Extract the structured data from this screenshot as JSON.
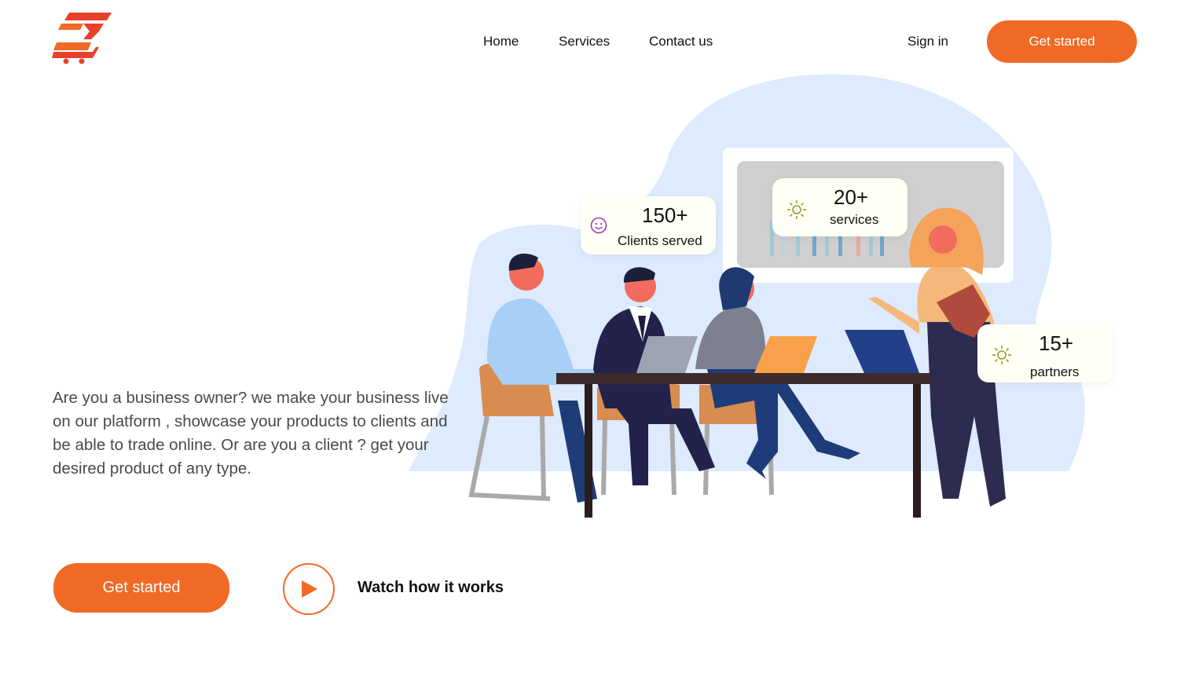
{
  "header": {
    "nav": [
      "Home",
      "Services",
      "Contact us"
    ],
    "sign_in": "Sign in",
    "cta": "Get started"
  },
  "hero": {
    "description": "Are you a business owner? we make your business live on our platform , showcase your products to clients and be able to trade online. Or are you a client ? get your desired product of any type.",
    "cta": "Get started",
    "watch_label": "Watch how it works"
  },
  "stats": [
    {
      "value": "150+",
      "label": "Clients served",
      "icon": "smiley-icon"
    },
    {
      "value": "20+",
      "label": "services",
      "icon": "sun-icon"
    },
    {
      "value": "15+",
      "label": "partners",
      "icon": "sun-icon"
    }
  ],
  "colors": {
    "accent": "#f06a25",
    "blob": "#deeafd",
    "logo_red": "#e8412b"
  }
}
